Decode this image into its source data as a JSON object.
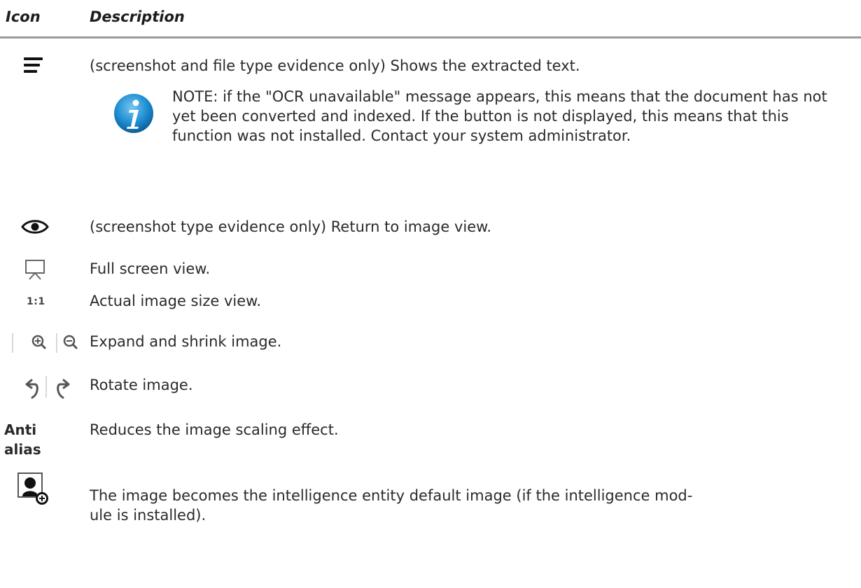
{
  "table": {
    "headers": {
      "icon": "Icon",
      "description": "Description"
    },
    "rows": [
      {
        "icon": "text-lines-icon",
        "description": "(screenshot and file type evidence only) Shows the extracted text.",
        "note": {
          "icon": "info-icon",
          "text": "NOTE: if the \"OCR unavailable\" message appears, this means that the document has not yet been converted and indexed. If the button is not displayed, this means that this function was not installed. Contact your system administrator."
        }
      },
      {
        "icon": "eye-icon",
        "description": "(screenshot type evidence only) Return to image view."
      },
      {
        "icon": "projector-screen-icon",
        "description": "Full screen view."
      },
      {
        "icon_text": "1:1",
        "description": "Actual image size view."
      },
      {
        "icon": "zoom-in-out-icons",
        "description": "Expand and shrink image."
      },
      {
        "icon": "rotate-left-right-icons",
        "description": "Rotate image."
      },
      {
        "icon_text": "Anti alias",
        "icon_text_lines": [
          "Anti",
          "alias"
        ],
        "description": "Reduces the image scaling effect."
      },
      {
        "icon": "user-add-image-icon",
        "description_lines": [
          "The image becomes the intelligence entity default image (if the intelligence mod-",
          "ule is installed)."
        ]
      }
    ]
  }
}
